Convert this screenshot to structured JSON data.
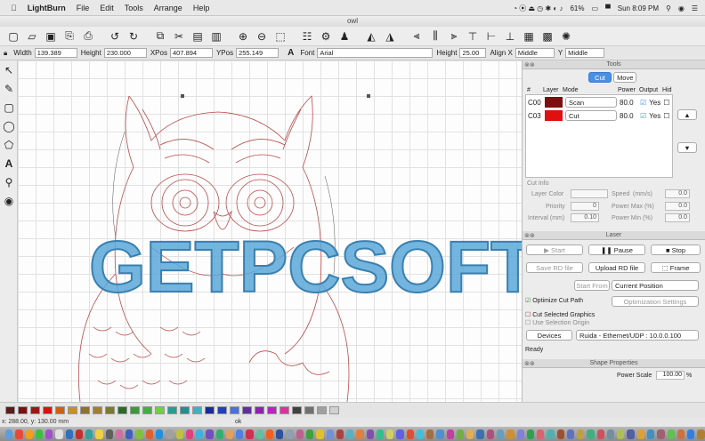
{
  "menubar": {
    "apple": "",
    "app": "LightBurn",
    "items": [
      "File",
      "Edit",
      "Tools",
      "Arrange",
      "Help"
    ],
    "battery": "61%",
    "clock": "Sun 8:09 PM"
  },
  "window": {
    "title": "owl"
  },
  "props": {
    "width_label": "Width",
    "width": "139.389",
    "height_label": "Height",
    "height": "230.000",
    "xpos_label": "XPos",
    "xpos": "407.894",
    "ypos_label": "YPos",
    "ypos": "255.149",
    "font_label": "Font",
    "font": "Arial",
    "fheight_label": "Height",
    "fheight": "25.00",
    "alignx_label": "Align X",
    "alignx": "Middle",
    "aligny_label": "Y",
    "aligny": "Middle"
  },
  "cuts": {
    "title": "Tools",
    "tab_cut": "Cut",
    "tab_move": "Move",
    "headers": [
      "#",
      "Layer",
      "Mode",
      "Power",
      "Output",
      "Hid"
    ],
    "rows": [
      {
        "num": "C00",
        "color": "#7a1010",
        "mode": "Scan",
        "power": "80.0",
        "output": "Yes"
      },
      {
        "num": "C03",
        "color": "#e01010",
        "mode": "Cut",
        "power": "80.0",
        "output": "Yes"
      }
    ],
    "cutinfo": "Cut Info",
    "layer_color": "Layer Color",
    "speed": "Speed",
    "speed_unit": "(mm/s)",
    "speed_val": "0.0",
    "priority": "Priority",
    "priority_val": "0",
    "pmax": "Power Max (%)",
    "pmax_val": "0.0",
    "interval": "Interval (mm)",
    "interval_val": "0.10",
    "pmin": "Power Min (%)",
    "pmin_val": "0.0"
  },
  "laser": {
    "title": "Laser",
    "start": "Start",
    "pause": "Pause",
    "stop": "Stop",
    "save_rd": "Save RD file",
    "upload_rd": "Upload RD file",
    "frame": "Frame",
    "start_from": "Start From",
    "start_from_val": "Current Position",
    "optimize": "Optimize Cut Path",
    "optimize_settings": "Optimization Settings",
    "cut_selected": "Cut Selected Graphics",
    "use_origin": "Use Selection Origin",
    "devices": "Devices",
    "device_val": "Ruida - Ethernet/UDP : 10.0.0.100",
    "status": "Ready"
  },
  "shape": {
    "title": "Shape Properties",
    "power_scale": "Power Scale",
    "power_scale_val": "100.00",
    "unit": "%"
  },
  "watermark": "GETPCSOFTS",
  "statusbar": {
    "coords": "x: 288.00, y: 130.00 mm",
    "ok": "ok"
  },
  "palette": [
    "#5a1b1b",
    "#7a1010",
    "#a01515",
    "#e01010",
    "#d06010",
    "#c89020",
    "#907030",
    "#a08030",
    "#7a7a2a",
    "#2a6a2a",
    "#3a9a3a",
    "#40b040",
    "#70d040",
    "#20a090",
    "#209090",
    "#40b0c0",
    "#1a2a9a",
    "#2040c0",
    "#4a70e0",
    "#6030a0",
    "#9020b0",
    "#c020c0",
    "#e030a0",
    "#404040",
    "#707070",
    "#a0a0a0",
    "#d0d0d0"
  ],
  "dock_colors": [
    "#5aa0e0",
    "#e84a3a",
    "#f0a020",
    "#3ac040",
    "#a050d0",
    "#e0e0e0",
    "#3070c0",
    "#c03030",
    "#30a0a0",
    "#f0d040",
    "#606060",
    "#d070a0",
    "#4060c0",
    "#80c040",
    "#e06030",
    "#2090e0",
    "#a0a0a0",
    "#c0c040",
    "#e04080",
    "#40b0e0",
    "#7050c0",
    "#30b070",
    "#e0a060",
    "#5080e0",
    "#d03050",
    "#60c0a0",
    "#f06020",
    "#3050a0",
    "#90a0b0",
    "#c06090",
    "#40a040",
    "#e0c030",
    "#7090e0",
    "#b04040",
    "#5ab0c0",
    "#e08040",
    "#8050b0",
    "#30c090",
    "#d0d060",
    "#6060e0",
    "#e05030",
    "#40c0e0",
    "#a07040",
    "#5090d0",
    "#c040a0",
    "#70b040",
    "#e0b050",
    "#4070b0",
    "#b05080",
    "#60a0c0",
    "#d09030",
    "#8080e0",
    "#30a050",
    "#e06070",
    "#50b0b0",
    "#a05030",
    "#6070c0",
    "#c0a040",
    "#40b080",
    "#d05060",
    "#7090a0",
    "#b0c050",
    "#5060a0",
    "#e0a030",
    "#4090c0",
    "#a06070",
    "#60c050",
    "#d07040",
    "#3080e0",
    "#b08030"
  ]
}
